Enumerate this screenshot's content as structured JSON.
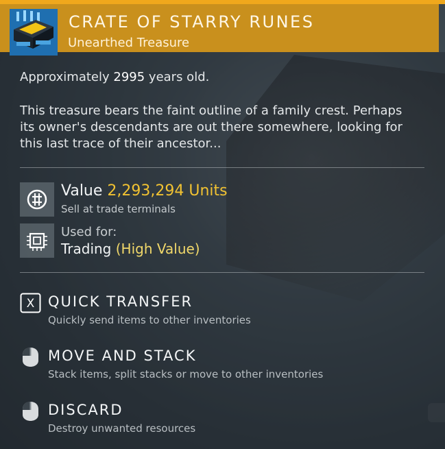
{
  "item": {
    "title": "CRATE OF STARRY RUNES",
    "subtitle": "Unearthed Treasure",
    "icon": "treasure-crate-icon"
  },
  "age": {
    "prefix": "Approximately",
    "years": "2995",
    "suffix": "years old."
  },
  "description": "This treasure bears the faint outline of a family crest. Perhaps its owner's descendants are out there somewhere, looking for this last trace of their ancestor...",
  "value": {
    "label": "Value",
    "amount": "2,293,294 Units",
    "note": "Sell at trade terminals",
    "icon": "units-currency-icon"
  },
  "usage": {
    "label": "Used for:",
    "category": "Trading",
    "detail": "(High Value)",
    "icon": "microchip-icon"
  },
  "actions": [
    {
      "key": "X",
      "title": "QUICK TRANSFER",
      "desc": "Quickly send items to other inventories",
      "icon": "x-key-icon"
    },
    {
      "key": "",
      "title": "MOVE AND STACK",
      "desc": "Stack items, split stacks or move to other inventories",
      "icon": "mouse-left-click-icon"
    },
    {
      "key": "",
      "title": "DISCARD",
      "desc": "Destroy unwanted resources",
      "icon": "mouse-left-click-icon"
    }
  ],
  "colors": {
    "header": "#c9901d",
    "accent": "#f0a81c",
    "value": "#f1c232",
    "highlight": "#f1d86a"
  }
}
